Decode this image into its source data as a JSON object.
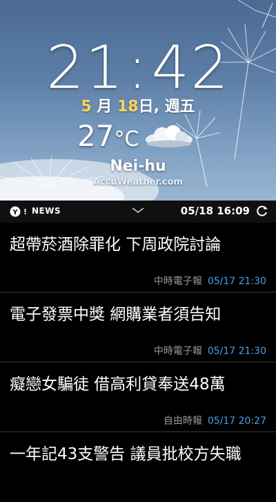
{
  "clock": {
    "hours": "21",
    "minutes": "42"
  },
  "date": {
    "month_num": "5",
    "month_suffix": " 月 ",
    "day_num": "18",
    "day_suffix": "日, 週五"
  },
  "weather": {
    "temperature": "27",
    "unit": "°C",
    "condition_icon": "partly-cloudy-icon",
    "city": "Nei-hu",
    "provider": "AccuWeather.com"
  },
  "news_bar": {
    "label": "NEWS",
    "logo_icon": "yahoo-logo-icon",
    "datetime": "05/18  16:09"
  },
  "news": [
    {
      "title": "超帶菸酒除罪化 下周政院討論",
      "source": "中時電子報",
      "time": "05/17  21:30"
    },
    {
      "title": "電子發票中獎 網購業者須告知",
      "source": "中時電子報",
      "time": "05/17  21:30"
    },
    {
      "title": "癡戀女騙徒 借高利貸奉送48萬",
      "source": "自由時報",
      "time": "05/17  20:27"
    },
    {
      "title": "一年記43支警告 議員批校方失職",
      "source": "",
      "time": ""
    }
  ],
  "colors": {
    "accent_date": "#ffd45a",
    "timestamp": "#4aa0e8"
  }
}
